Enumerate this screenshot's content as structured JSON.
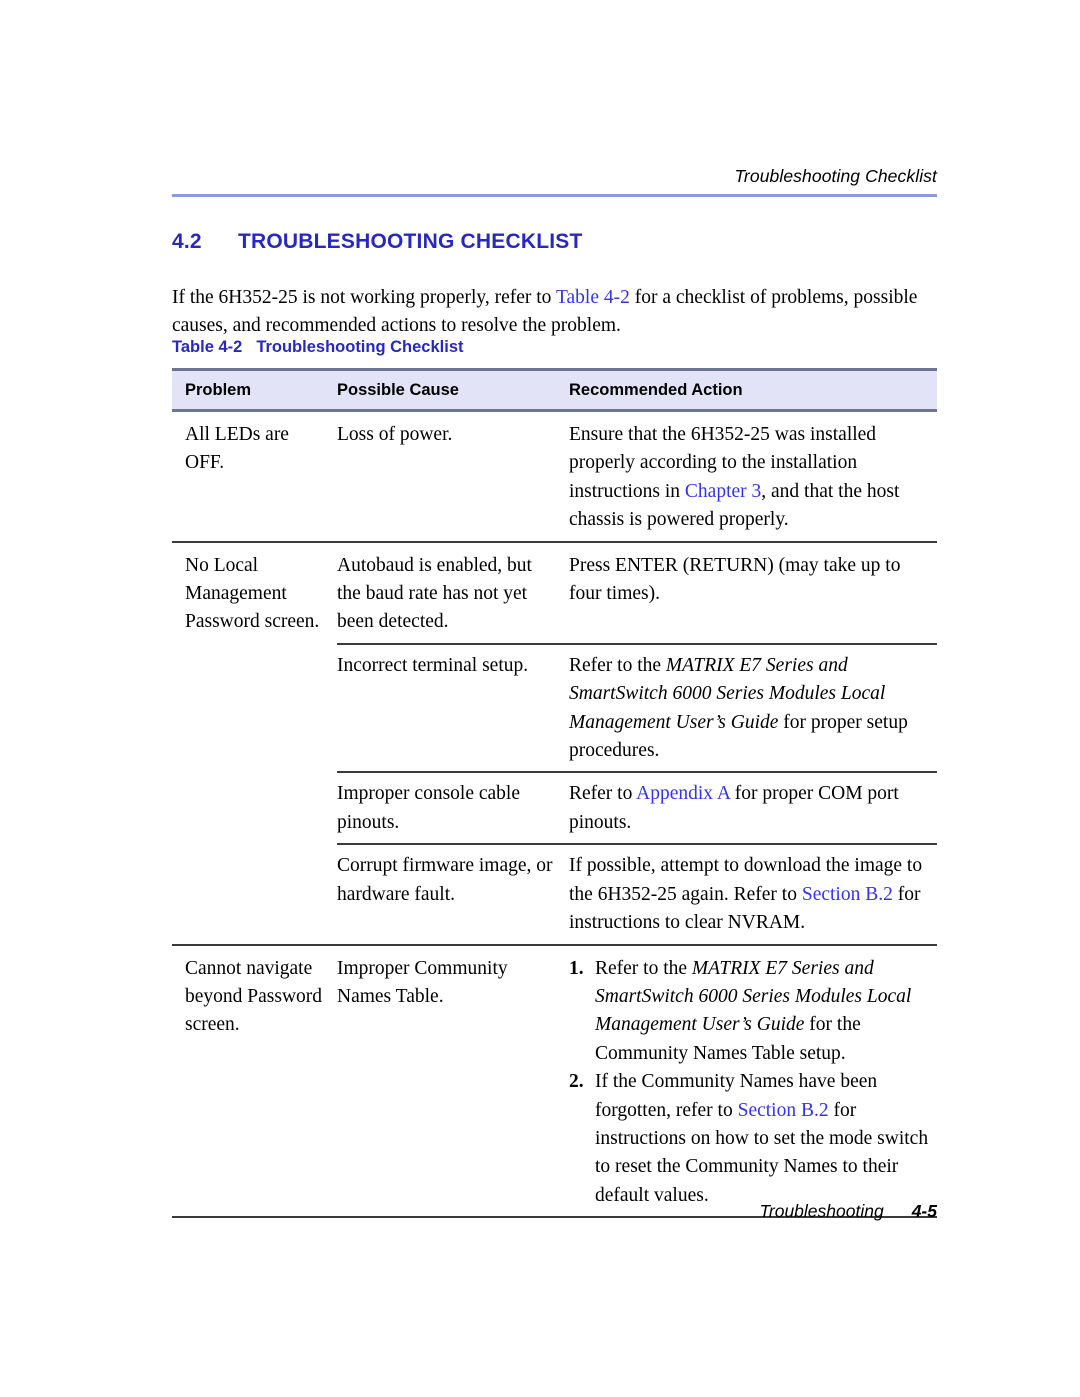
{
  "page": {
    "running_header": "Troubleshooting Checklist",
    "footer_section": "Troubleshooting",
    "footer_page": "4-5"
  },
  "colors": {
    "heading_blue": "#2828c0",
    "link_blue": "#3333ee",
    "rule_blue": "#8a9bdd",
    "table_header_bg": "#e3e3f7",
    "table_header_border": "#6e7590",
    "row_rule": "#3a3a3a"
  },
  "section": {
    "number": "4.2",
    "title": "TROUBLESHOOTING CHECKLIST"
  },
  "intro": {
    "part1": "If the 6H352-25 is not working properly, refer to ",
    "link1": "Table 4-2",
    "part2": " for a checklist of problems, possible causes, and recommended actions to resolve the problem."
  },
  "table": {
    "caption_number": "Table 4-2",
    "caption_title": "Troubleshooting Checklist",
    "headers": {
      "problem": "Problem",
      "cause": "Possible Cause",
      "action": "Recommended Action"
    },
    "rows": [
      {
        "problem": "All LEDs are OFF.",
        "subrows": [
          {
            "cause": "Loss of power.",
            "action_part1": "Ensure that the 6H352-25 was installed properly according to the installation instructions in ",
            "action_link": "Chapter 3",
            "action_part2": ", and that the host chassis is powered properly."
          }
        ]
      },
      {
        "problem": "No Local Management Password screen.",
        "subrows": [
          {
            "cause": "Autobaud is enabled, but the baud rate has not yet been detected.",
            "action_part1": "Press ENTER (RETURN) (may take up to four times).",
            "action_link": "",
            "action_part2": ""
          },
          {
            "cause": "Incorrect terminal setup.",
            "action_part1": "Refer to the ",
            "action_italic": "MATRIX E7 Series and SmartSwitch 6000 Series Modules Local Management User’s Guide",
            "action_part2": " for proper setup procedures."
          },
          {
            "cause": "Improper console cable pinouts.",
            "action_part1": "Refer to ",
            "action_link": "Appendix A",
            "action_part2": " for proper COM port pinouts."
          },
          {
            "cause": "Corrupt firmware image, or hardware fault.",
            "action_part1": "If possible, attempt to download the image to the 6H352-25 again. Refer to ",
            "action_link": "Section B.2",
            "action_part2": " for instructions to clear NVRAM."
          }
        ]
      },
      {
        "problem": "Cannot navigate beyond Password screen.",
        "subrows": [
          {
            "cause": "Improper Community Names Table.",
            "list": [
              {
                "marker": "1.",
                "part1": "Refer to the ",
                "italic": "MATRIX E7 Series and SmartSwitch 6000 Series Modules Local Management User’s Guide",
                "part2": " for the Community Names Table setup."
              },
              {
                "marker": "2.",
                "part1": "If the Community Names have been forgotten, refer to ",
                "link": "Section B.2",
                "part2": " for instructions on how to set the mode switch to reset the Community Names to their default values."
              }
            ]
          }
        ]
      }
    ]
  }
}
